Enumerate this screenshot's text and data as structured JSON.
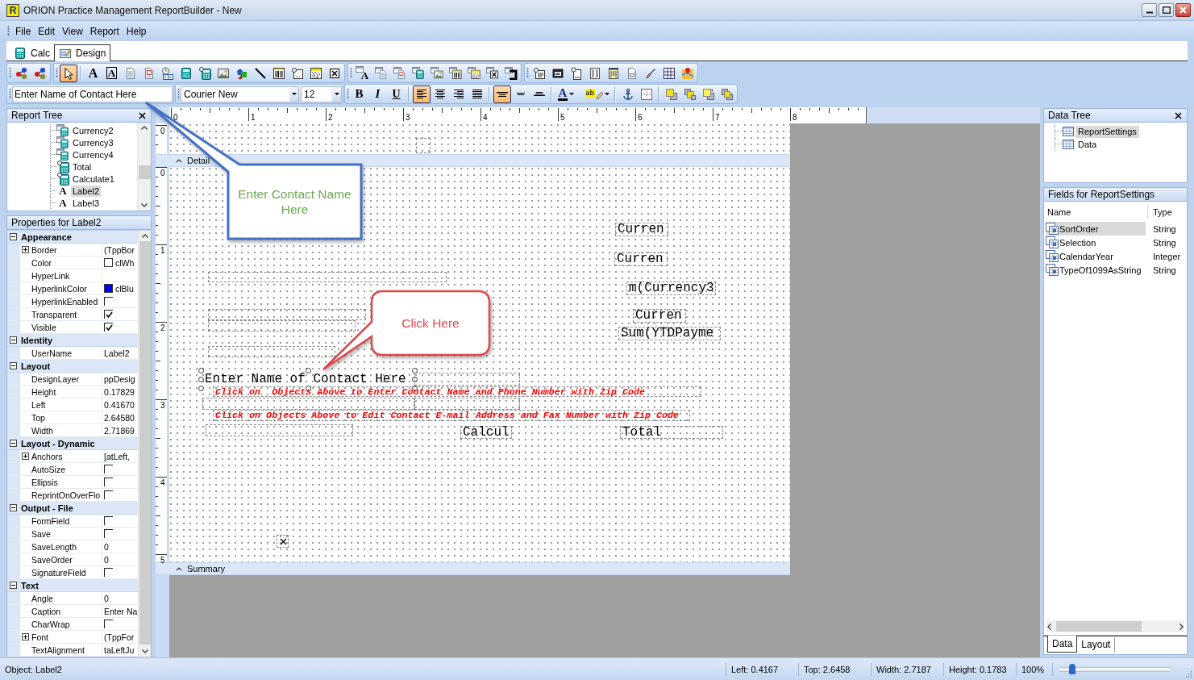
{
  "window": {
    "title": "ORION Practice Management ReportBuilder - New",
    "logo_glyph": "R"
  },
  "menu": [
    "File",
    "Edit",
    "View",
    "Report",
    "Help"
  ],
  "mode_tabs": [
    {
      "label": "Calc",
      "kind": "calculator",
      "selected": false
    },
    {
      "label": "Design",
      "kind": "design",
      "selected": true
    }
  ],
  "component_toolbars": [
    {
      "groups": [
        [
          {
            "kind": "nodes",
            "selected": false
          },
          {
            "kind": "nodes",
            "selected": false
          }
        ]
      ]
    },
    {
      "groups": [
        [
          {
            "kind": "pointer",
            "selected": true
          }
        ],
        [
          {
            "kind": "letter",
            "glyph": "A",
            "selected": false
          },
          {
            "kind": "framed-letter",
            "glyph": "A",
            "selected": false
          },
          {
            "kind": "page",
            "selected": false
          },
          {
            "kind": "page-letter",
            "selected": false
          },
          {
            "kind": "clock-digits",
            "selected": false
          },
          {
            "kind": "calculator",
            "selected": false
          },
          {
            "kind": "calculator-pin",
            "selected": false
          },
          {
            "kind": "picture",
            "selected": false
          },
          {
            "kind": "shapes",
            "selected": false
          },
          {
            "kind": "line",
            "selected": false
          },
          {
            "kind": "barcode",
            "selected": false
          },
          {
            "kind": "region",
            "selected": false
          },
          {
            "kind": "matrix",
            "selected": false
          },
          {
            "kind": "cross-box",
            "selected": false
          }
        ]
      ]
    },
    {
      "groups": [
        [
          {
            "kind": "db-letter",
            "glyph": "A",
            "selected": false
          },
          {
            "kind": "db-page",
            "selected": false
          },
          {
            "kind": "db-page-letter",
            "selected": false
          },
          {
            "kind": "db-calculator",
            "selected": false
          },
          {
            "kind": "db-picture",
            "selected": false
          },
          {
            "kind": "db-barcode",
            "selected": false
          },
          {
            "kind": "db-matrix",
            "selected": false
          },
          {
            "kind": "db-cross-box",
            "selected": false
          },
          {
            "kind": "db-bracket",
            "selected": false
          }
        ]
      ]
    },
    {
      "groups": [
        [
          {
            "kind": "pinned-list",
            "selected": false
          },
          {
            "kind": "dark-window",
            "selected": false
          },
          {
            "kind": "pinned-page",
            "selected": false
          },
          {
            "kind": "columns",
            "selected": false
          },
          {
            "kind": "yellow-columns",
            "selected": false
          },
          {
            "kind": "page-tab",
            "selected": false
          },
          {
            "kind": "brush",
            "selected": false
          },
          {
            "kind": "table",
            "selected": false
          },
          {
            "kind": "map",
            "selected": false
          }
        ]
      ]
    }
  ],
  "format_toolbar": {
    "caption_field": "Enter Name of Contact Here",
    "font_name": "Courier New",
    "font_size": "12",
    "groups": [
      [
        {
          "kind": "bold",
          "glyph": "B",
          "selected": false
        },
        {
          "kind": "italic",
          "glyph": "I",
          "selected": false
        },
        {
          "kind": "underline",
          "glyph": "U",
          "selected": false
        }
      ],
      [
        {
          "kind": "align-left",
          "selected": true
        },
        {
          "kind": "align-center",
          "selected": false
        },
        {
          "kind": "align-right",
          "selected": false
        },
        {
          "kind": "justify",
          "selected": false
        }
      ],
      [
        {
          "kind": "align-top",
          "selected": true
        },
        {
          "kind": "align-middle",
          "selected": false
        },
        {
          "kind": "align-bottom",
          "selected": false
        }
      ],
      [
        {
          "kind": "font-color",
          "glyph": "A",
          "selected": false
        },
        {
          "kind": "highlight",
          "glyph": "ab",
          "selected": false
        }
      ],
      [
        {
          "kind": "anchor",
          "selected": false
        },
        {
          "kind": "snap-grid",
          "selected": false
        }
      ],
      [
        {
          "kind": "bring-front",
          "selected": false
        },
        {
          "kind": "send-back",
          "selected": false
        },
        {
          "kind": "bring-forward",
          "selected": false
        },
        {
          "kind": "send-backward",
          "selected": false
        }
      ]
    ]
  },
  "report_tree": {
    "title": "Report Tree",
    "items": [
      {
        "label": "Currency2",
        "kind": "db-calculator",
        "selected": false
      },
      {
        "label": "Currency3",
        "kind": "db-calculator",
        "selected": false
      },
      {
        "label": "Currency4",
        "kind": "db-calculator",
        "selected": false
      },
      {
        "label": "Total",
        "kind": "calculator-pin",
        "selected": false
      },
      {
        "label": "Calculate1",
        "kind": "calculator-pin",
        "selected": false
      },
      {
        "label": "Label2",
        "kind": "label",
        "glyph": "A",
        "selected": true
      },
      {
        "label": "Label3",
        "kind": "label",
        "glyph": "A",
        "selected": false
      }
    ]
  },
  "properties": {
    "title": "Properties for Label2",
    "categories": [
      {
        "name": "Appearance",
        "expanded": true,
        "rows": [
          {
            "name": "Border",
            "kind": "expandable",
            "value": "(TppBor"
          },
          {
            "name": "Color",
            "kind": "color",
            "color": "#ffffff",
            "value": "clWh"
          },
          {
            "name": "HyperLink",
            "kind": "text"
          },
          {
            "name": "HyperlinkColor",
            "kind": "color",
            "color": "#0000ff",
            "value": "clBlu"
          },
          {
            "name": "HyperlinkEnabled",
            "kind": "checkbox",
            "checked": false
          },
          {
            "name": "Transparent",
            "kind": "checkbox",
            "checked": true
          },
          {
            "name": "Visible",
            "kind": "checkbox",
            "checked": true
          }
        ]
      },
      {
        "name": "Identity",
        "expanded": true,
        "rows": [
          {
            "name": "UserName",
            "kind": "text",
            "value": "Label2"
          }
        ]
      },
      {
        "name": "Layout",
        "expanded": true,
        "rows": [
          {
            "name": "DesignLayer",
            "kind": "text",
            "value": "ppDesig"
          },
          {
            "name": "Height",
            "kind": "text",
            "value": "0.17829"
          },
          {
            "name": "Left",
            "kind": "text",
            "value": "0.41670"
          },
          {
            "name": "Top",
            "kind": "text",
            "value": "2.64580"
          },
          {
            "name": "Width",
            "kind": "text",
            "value": "2.71869"
          }
        ]
      },
      {
        "name": "Layout - Dynamic",
        "expanded": true,
        "rows": [
          {
            "name": "Anchors",
            "kind": "expandable",
            "value": "[atLeft,"
          },
          {
            "name": "AutoSize",
            "kind": "checkbox",
            "checked": false
          },
          {
            "name": "Ellipsis",
            "kind": "checkbox",
            "checked": false
          },
          {
            "name": "ReprintOnOverFlo",
            "kind": "checkbox",
            "checked": false
          }
        ]
      },
      {
        "name": "Output - File",
        "expanded": true,
        "rows": [
          {
            "name": "FormField",
            "kind": "checkbox",
            "checked": false
          },
          {
            "name": "Save",
            "kind": "checkbox",
            "checked": false
          },
          {
            "name": "SaveLength",
            "kind": "text",
            "value": "0"
          },
          {
            "name": "SaveOrder",
            "kind": "text",
            "value": "0"
          },
          {
            "name": "SignatureField",
            "kind": "checkbox",
            "checked": false
          }
        ]
      },
      {
        "name": "Text",
        "expanded": true,
        "rows": [
          {
            "name": "Angle",
            "kind": "text",
            "value": "0"
          },
          {
            "name": "Caption",
            "kind": "text",
            "value": "Enter Na"
          },
          {
            "name": "CharWrap",
            "kind": "checkbox",
            "checked": false
          },
          {
            "name": "Font",
            "kind": "expandable",
            "value": "(TppFor"
          },
          {
            "name": "TextAlignment",
            "kind": "text",
            "value": "taLeftJu"
          }
        ]
      }
    ]
  },
  "designer": {
    "ruler_marks": [
      "0",
      "1",
      "2",
      "3",
      "4",
      "5",
      "6",
      "7",
      "8"
    ],
    "bands": [
      {
        "ruler_marks": [
          "0"
        ],
        "objects": [
          {
            "kind": "blank",
            "selected": false
          }
        ]
      },
      {
        "label": "Detail",
        "ruler_marks": [
          "0",
          "1",
          "2",
          "3",
          "4",
          "5"
        ],
        "objects": [
          {
            "kind": "field",
            "text": "Curren",
            "selected": false
          },
          {
            "kind": "field",
            "text": "Curren",
            "selected": false
          },
          {
            "kind": "field",
            "text": "m(Currency3",
            "selected": false
          },
          {
            "kind": "field",
            "text": "Curren",
            "selected": false
          },
          {
            "kind": "field",
            "text": "Sum(YTDPayme",
            "selected": false
          },
          {
            "kind": "blank",
            "selected": false
          },
          {
            "kind": "blank",
            "selected": false
          },
          {
            "kind": "blank",
            "selected": false
          },
          {
            "kind": "blank",
            "selected": false
          },
          {
            "kind": "label",
            "text": "Enter Name of Contact Here",
            "selected": true
          },
          {
            "kind": "blank",
            "selected": false
          },
          {
            "kind": "note",
            "text": "Click on  Objects Above to Enter Contact Name and Phone Number with Zip Code",
            "selected": false
          },
          {
            "kind": "blank",
            "selected": false
          },
          {
            "kind": "blank",
            "selected": false
          },
          {
            "kind": "note",
            "text": "Click on Objects Above to Edit Contact E-mail Address and Fax Number with Zip Code",
            "selected": false
          },
          {
            "kind": "blank",
            "selected": false
          },
          {
            "kind": "field",
            "text": "Calcul",
            "selected": false
          },
          {
            "kind": "field",
            "text": "Total",
            "selected": false
          },
          {
            "kind": "checkbox",
            "checked": true
          }
        ]
      },
      {
        "label": "Summary"
      }
    ]
  },
  "data_tree": {
    "title": "Data Tree",
    "items": [
      {
        "label": "ReportSettings",
        "selected": true
      },
      {
        "label": "Data",
        "selected": false
      }
    ]
  },
  "fields": {
    "title": "Fields for ReportSettings",
    "columns": [
      "Name",
      "Type"
    ],
    "rows": [
      {
        "name": "SortOrder",
        "type": "String",
        "selected": true
      },
      {
        "name": "Selection",
        "type": "String",
        "selected": false
      },
      {
        "name": "CalendarYear",
        "type": "Integer",
        "selected": false
      },
      {
        "name": "TypeOf1099AsString",
        "type": "String",
        "selected": false
      }
    ]
  },
  "data_tabs": [
    {
      "label": "Data",
      "selected": true
    },
    {
      "label": "Layout",
      "selected": false
    }
  ],
  "callouts": [
    {
      "kind": "rectangle",
      "text": "Enter Contact Name Here"
    },
    {
      "kind": "rounded",
      "text": "Click Here"
    }
  ],
  "status_bar": {
    "object": "Object: Label2",
    "fields": [
      "Left: 0.4167",
      "Top: 2.6458",
      "Width: 2.7187",
      "Height: 0.1783"
    ],
    "zoom": "100%",
    "zoom_slider": {
      "level": 0.12
    }
  }
}
